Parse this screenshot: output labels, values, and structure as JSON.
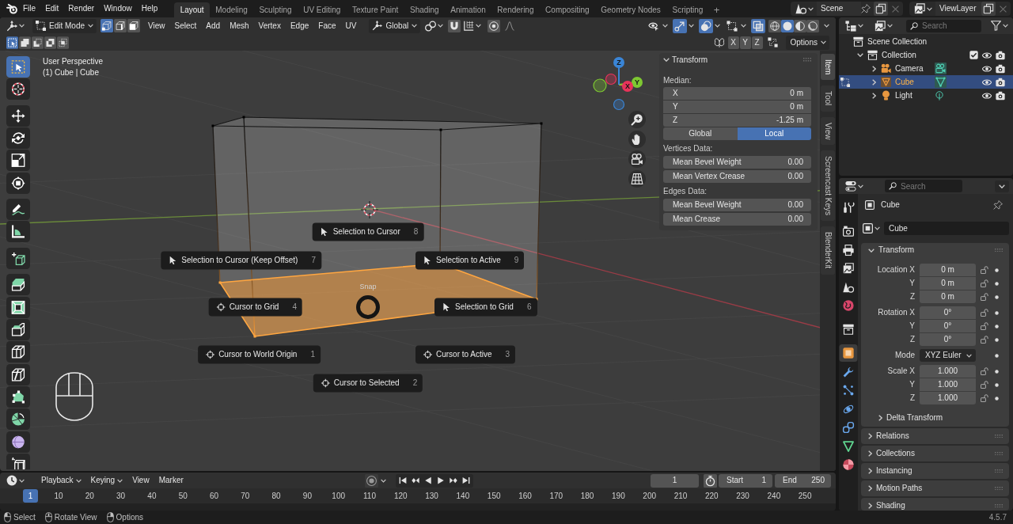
{
  "top_bar": {
    "menus": [
      "File",
      "Edit",
      "Render",
      "Window",
      "Help"
    ],
    "workspaces": [
      {
        "label": "Layout",
        "selected": true
      },
      {
        "label": "Modeling",
        "selected": false
      },
      {
        "label": "Sculpting",
        "selected": false
      },
      {
        "label": "UV Editing",
        "selected": false
      },
      {
        "label": "Texture Paint",
        "selected": false
      },
      {
        "label": "Shading",
        "selected": false
      },
      {
        "label": "Animation",
        "selected": false
      },
      {
        "label": "Rendering",
        "selected": false
      },
      {
        "label": "Compositing",
        "selected": false
      },
      {
        "label": "Geometry Nodes",
        "selected": false
      },
      {
        "label": "Scripting",
        "selected": false
      }
    ],
    "add_workspace": "+",
    "scene": "Scene",
    "view_layer": "ViewLayer"
  },
  "viewport": {
    "header": {
      "mode": "Edit Mode",
      "select_modes": [
        {
          "kind": "vertex",
          "selected": true
        },
        {
          "kind": "edge",
          "selected": false
        },
        {
          "kind": "face",
          "selected": false
        }
      ],
      "menus": [
        "View",
        "Select",
        "Add",
        "Mesh",
        "Vertex",
        "Edge",
        "Face",
        "UV"
      ],
      "orientation": "Global",
      "snapping": false,
      "proportional_editing": false,
      "toggles": [
        {
          "kind": "selectability",
          "on": false
        },
        {
          "kind": "gizmo",
          "on": true
        },
        {
          "kind": "overlays",
          "on": true
        },
        {
          "kind": "mesh-overlays",
          "on": false
        },
        {
          "kind": "xray",
          "on": true
        }
      ],
      "shading_modes": [
        {
          "kind": "wireframe",
          "selected": false
        },
        {
          "kind": "solid",
          "selected": true
        },
        {
          "kind": "material",
          "selected": false
        },
        {
          "kind": "rendered",
          "selected": false
        }
      ]
    },
    "tool_header": {
      "select_operations": [
        {
          "kind": "set",
          "selected": true
        },
        {
          "kind": "extend",
          "selected": false
        },
        {
          "kind": "subtract",
          "selected": false
        },
        {
          "kind": "invert",
          "selected": false
        },
        {
          "kind": "intersect",
          "selected": false
        }
      ],
      "mirror_axes": [
        {
          "label": "X",
          "on": false
        },
        {
          "label": "Y",
          "on": false
        },
        {
          "label": "Z",
          "on": false
        }
      ],
      "options": "Options"
    },
    "tool_groups": [
      [
        {
          "kind": "select-box",
          "selected": true
        },
        {
          "kind": "cursor",
          "selected": false
        }
      ],
      [
        {
          "kind": "move",
          "selected": false
        },
        {
          "kind": "rotate",
          "selected": false
        },
        {
          "kind": "scale",
          "selected": false
        },
        {
          "kind": "transform",
          "selected": false
        }
      ],
      [
        {
          "kind": "annotate",
          "selected": false
        },
        {
          "kind": "measure",
          "selected": false
        }
      ],
      [
        {
          "kind": "add-cube",
          "selected": false
        }
      ],
      [
        {
          "kind": "extrude",
          "selected": false
        },
        {
          "kind": "inset",
          "selected": false
        },
        {
          "kind": "bevel",
          "selected": false
        },
        {
          "kind": "loop-cut",
          "selected": false
        },
        {
          "kind": "knife",
          "selected": false
        },
        {
          "kind": "poly-build",
          "selected": false
        },
        {
          "kind": "spin",
          "selected": false
        },
        {
          "kind": "smooth",
          "selected": false
        },
        {
          "kind": "edge-slide",
          "selected": false
        }
      ]
    ],
    "view_name": "User Perspective",
    "object_info": "(1) Cube | Cube",
    "navigation_axes": [
      {
        "label": "X",
        "color": "#e8335a"
      },
      {
        "label": "Y",
        "color": "#7ec832"
      },
      {
        "label": "Z",
        "color": "#3a85d6"
      }
    ],
    "snap_pie": {
      "title": "Snap",
      "items": [
        {
          "label": "Selection to Cursor",
          "hotkey": "8",
          "kind": "selection"
        },
        {
          "label": "Selection to Cursor (Keep Offset)",
          "hotkey": "7",
          "kind": "selection"
        },
        {
          "label": "Selection to Active",
          "hotkey": "9",
          "kind": "selection"
        },
        {
          "label": "Cursor to Grid",
          "hotkey": "4",
          "kind": "cursor"
        },
        {
          "label": "Selection to Grid",
          "hotkey": "6",
          "kind": "selection"
        },
        {
          "label": "Cursor to World Origin",
          "hotkey": "1",
          "kind": "cursor"
        },
        {
          "label": "Cursor to Active",
          "hotkey": "3",
          "kind": "cursor"
        },
        {
          "label": "Cursor to Selected",
          "hotkey": "2",
          "kind": "cursor"
        }
      ]
    },
    "sidebar": {
      "tabs": [
        {
          "label": "Item",
          "selected": true
        },
        {
          "label": "Tool",
          "selected": false
        },
        {
          "label": "View",
          "selected": false
        },
        {
          "label": "Screencast Keys",
          "selected": false
        },
        {
          "label": "BlenderKit",
          "selected": false
        }
      ],
      "panel": {
        "title": "Transform",
        "expanded": true,
        "median_label": "Median:",
        "median": [
          {
            "label": "X",
            "value": "0 m"
          },
          {
            "label": "Y",
            "value": "0 m"
          },
          {
            "label": "Z",
            "value": "-1.25 m"
          }
        ],
        "spaces": [
          {
            "label": "Global",
            "selected": false
          },
          {
            "label": "Local",
            "selected": true
          }
        ],
        "groups": [
          {
            "title": "Vertices Data:",
            "fields": [
              {
                "label": "Mean Bevel Weight",
                "value": "0.00"
              },
              {
                "label": "Mean Vertex Crease",
                "value": "0.00"
              }
            ]
          },
          {
            "title": "Edges Data:",
            "fields": [
              {
                "label": "Mean Bevel Weight",
                "value": "0.00"
              },
              {
                "label": "Mean Crease",
                "value": "0.00"
              }
            ]
          }
        ]
      }
    }
  },
  "outliner": {
    "search": {
      "placeholder": "Search"
    },
    "tree": [
      {
        "label": "Scene Collection",
        "kind": "scene-collection",
        "selected": false,
        "children": [
          {
            "label": "Collection",
            "kind": "collection",
            "selected": false,
            "expanded": true,
            "checked": true,
            "children": [
              {
                "label": "Camera",
                "kind": "camera",
                "selected": false,
                "expanded": false,
                "editing": false
              },
              {
                "label": "Cube",
                "kind": "mesh",
                "selected": true,
                "expanded": false,
                "editing": true
              },
              {
                "label": "Light",
                "kind": "light",
                "selected": false,
                "expanded": false,
                "editing": false
              }
            ]
          }
        ]
      }
    ]
  },
  "properties": {
    "search": {
      "placeholder": "Search"
    },
    "tabs": [
      [
        {
          "kind": "tool",
          "selected": false
        }
      ],
      [
        {
          "kind": "render",
          "selected": false
        },
        {
          "kind": "output",
          "selected": false
        },
        {
          "kind": "view-layer",
          "selected": false
        },
        {
          "kind": "scene",
          "selected": false
        },
        {
          "kind": "world",
          "selected": false
        }
      ],
      [
        {
          "kind": "collection",
          "selected": false
        }
      ],
      [
        {
          "kind": "object",
          "selected": true
        },
        {
          "kind": "modifiers",
          "selected": false
        },
        {
          "kind": "particles",
          "selected": false
        },
        {
          "kind": "physics",
          "selected": false
        },
        {
          "kind": "constraints",
          "selected": false
        },
        {
          "kind": "data",
          "selected": false
        },
        {
          "kind": "material",
          "selected": false
        }
      ]
    ],
    "context": "Cube",
    "name": "Cube",
    "transform": {
      "title": "Transform",
      "expanded": true,
      "groups": [
        {
          "kind": "number",
          "rows": [
            {
              "label": "Location X",
              "value": "0 m",
              "locked": false
            },
            {
              "label": "Y",
              "value": "0 m",
              "locked": false
            },
            {
              "label": "Z",
              "value": "0 m",
              "locked": false
            }
          ]
        },
        {
          "kind": "number",
          "rows": [
            {
              "label": "Rotation X",
              "value": "0°",
              "locked": false
            },
            {
              "label": "Y",
              "value": "0°",
              "locked": false
            },
            {
              "label": "Z",
              "value": "0°",
              "locked": false
            }
          ]
        },
        {
          "kind": "dropdown",
          "rows": [
            {
              "label": "Mode",
              "value": "XYZ Euler"
            }
          ]
        },
        {
          "kind": "number",
          "rows": [
            {
              "label": "Scale X",
              "value": "1.000",
              "locked": false
            },
            {
              "label": "Y",
              "value": "1.000",
              "locked": false
            },
            {
              "label": "Z",
              "value": "1.000",
              "locked": false
            }
          ]
        }
      ],
      "subpanels": [
        {
          "label": "Delta Transform",
          "expanded": false
        }
      ]
    },
    "panels": [
      {
        "label": "Relations",
        "expanded": false
      },
      {
        "label": "Collections",
        "expanded": false
      },
      {
        "label": "Instancing",
        "expanded": false
      },
      {
        "label": "Motion Paths",
        "expanded": false
      },
      {
        "label": "Shading",
        "expanded": false
      }
    ]
  },
  "timeline": {
    "menus": [
      {
        "label": "Playback",
        "dropdown": true
      },
      {
        "label": "Keying",
        "dropdown": true
      },
      {
        "label": "View",
        "dropdown": false
      },
      {
        "label": "Marker",
        "dropdown": false
      }
    ],
    "auto_keying": false,
    "current_frame": "1",
    "start": {
      "label": "Start",
      "value": "1"
    },
    "end": {
      "label": "End",
      "value": "250"
    },
    "ruler": [
      {
        "label": "1",
        "selected": true
      },
      {
        "label": "10",
        "selected": false
      },
      {
        "label": "20",
        "selected": false
      },
      {
        "label": "30",
        "selected": false
      },
      {
        "label": "40",
        "selected": false
      },
      {
        "label": "50",
        "selected": false
      },
      {
        "label": "60",
        "selected": false
      },
      {
        "label": "70",
        "selected": false
      },
      {
        "label": "80",
        "selected": false
      },
      {
        "label": "90",
        "selected": false
      },
      {
        "label": "100",
        "selected": false
      },
      {
        "label": "110",
        "selected": false
      },
      {
        "label": "120",
        "selected": false
      },
      {
        "label": "130",
        "selected": false
      },
      {
        "label": "140",
        "selected": false
      },
      {
        "label": "150",
        "selected": false
      },
      {
        "label": "160",
        "selected": false
      },
      {
        "label": "170",
        "selected": false
      },
      {
        "label": "180",
        "selected": false
      },
      {
        "label": "190",
        "selected": false
      },
      {
        "label": "200",
        "selected": false
      },
      {
        "label": "210",
        "selected": false
      },
      {
        "label": "220",
        "selected": false
      },
      {
        "label": "230",
        "selected": false
      },
      {
        "label": "240",
        "selected": false
      },
      {
        "label": "250",
        "selected": false
      }
    ]
  },
  "status_bar": {
    "hints": [
      {
        "kind": "left",
        "label": "Select"
      },
      {
        "kind": "middle",
        "label": "Rotate View"
      },
      {
        "kind": "right",
        "label": "Options"
      }
    ],
    "version": "4.5.7"
  }
}
